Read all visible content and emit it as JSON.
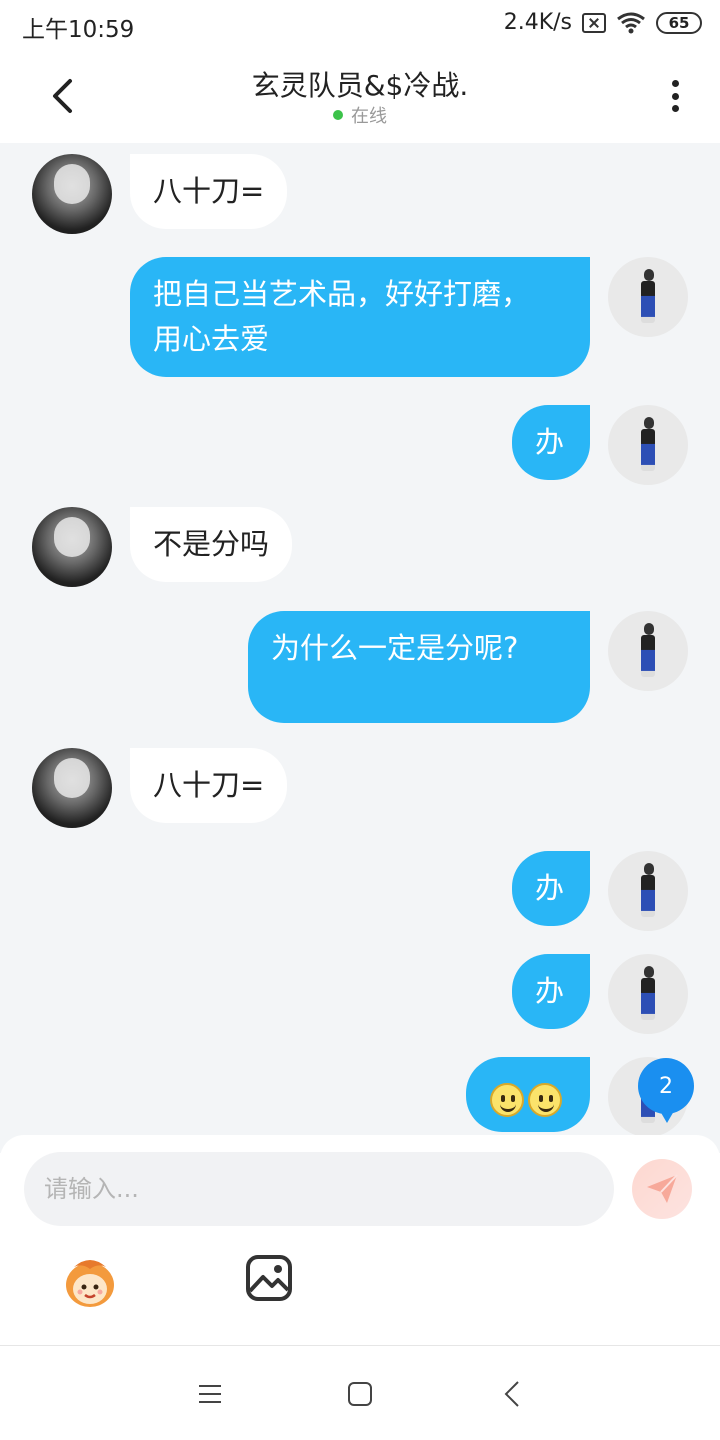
{
  "status_bar": {
    "time": "上午10:59",
    "network_speed": "2.4K/s",
    "battery": "65",
    "icons": [
      "sim-off-icon",
      "wifi-icon",
      "battery-icon"
    ]
  },
  "header": {
    "title": "玄灵队员&$冷战.",
    "presence": "在线",
    "presence_color": "#3cc24a",
    "back_icon": "chevron-left-icon",
    "more_icon": "more-vertical-icon"
  },
  "chat": {
    "background": "#f3f5f7",
    "bubble_me_color": "#29b6f6",
    "bubble_them_color": "#ffffff",
    "messages": [
      {
        "from": "them",
        "text": "八十刀="
      },
      {
        "from": "me",
        "lines": [
          "把自己当艺术品，好好打磨，",
          "用心去爱"
        ]
      },
      {
        "from": "me",
        "text": "办"
      },
      {
        "from": "them",
        "text": "不是分吗"
      },
      {
        "from": "me",
        "text": "为什么一定是分呢?"
      },
      {
        "from": "them",
        "text": "八十刀="
      },
      {
        "from": "me",
        "text": "办"
      },
      {
        "from": "me",
        "text": "办"
      },
      {
        "from": "me",
        "emoji": [
          "smile-emoji",
          "smile-emoji"
        ]
      }
    ],
    "unread_badge": "2",
    "unread_color": "#1a8ff0"
  },
  "input": {
    "placeholder": "请输入...",
    "value": "",
    "send_icon": "paper-plane-icon",
    "tools": [
      "emoji-sticker-icon",
      "image-icon"
    ]
  },
  "nav_bar": {
    "icons": [
      "menu-icon",
      "home-square-icon",
      "back-triangle-icon"
    ]
  }
}
